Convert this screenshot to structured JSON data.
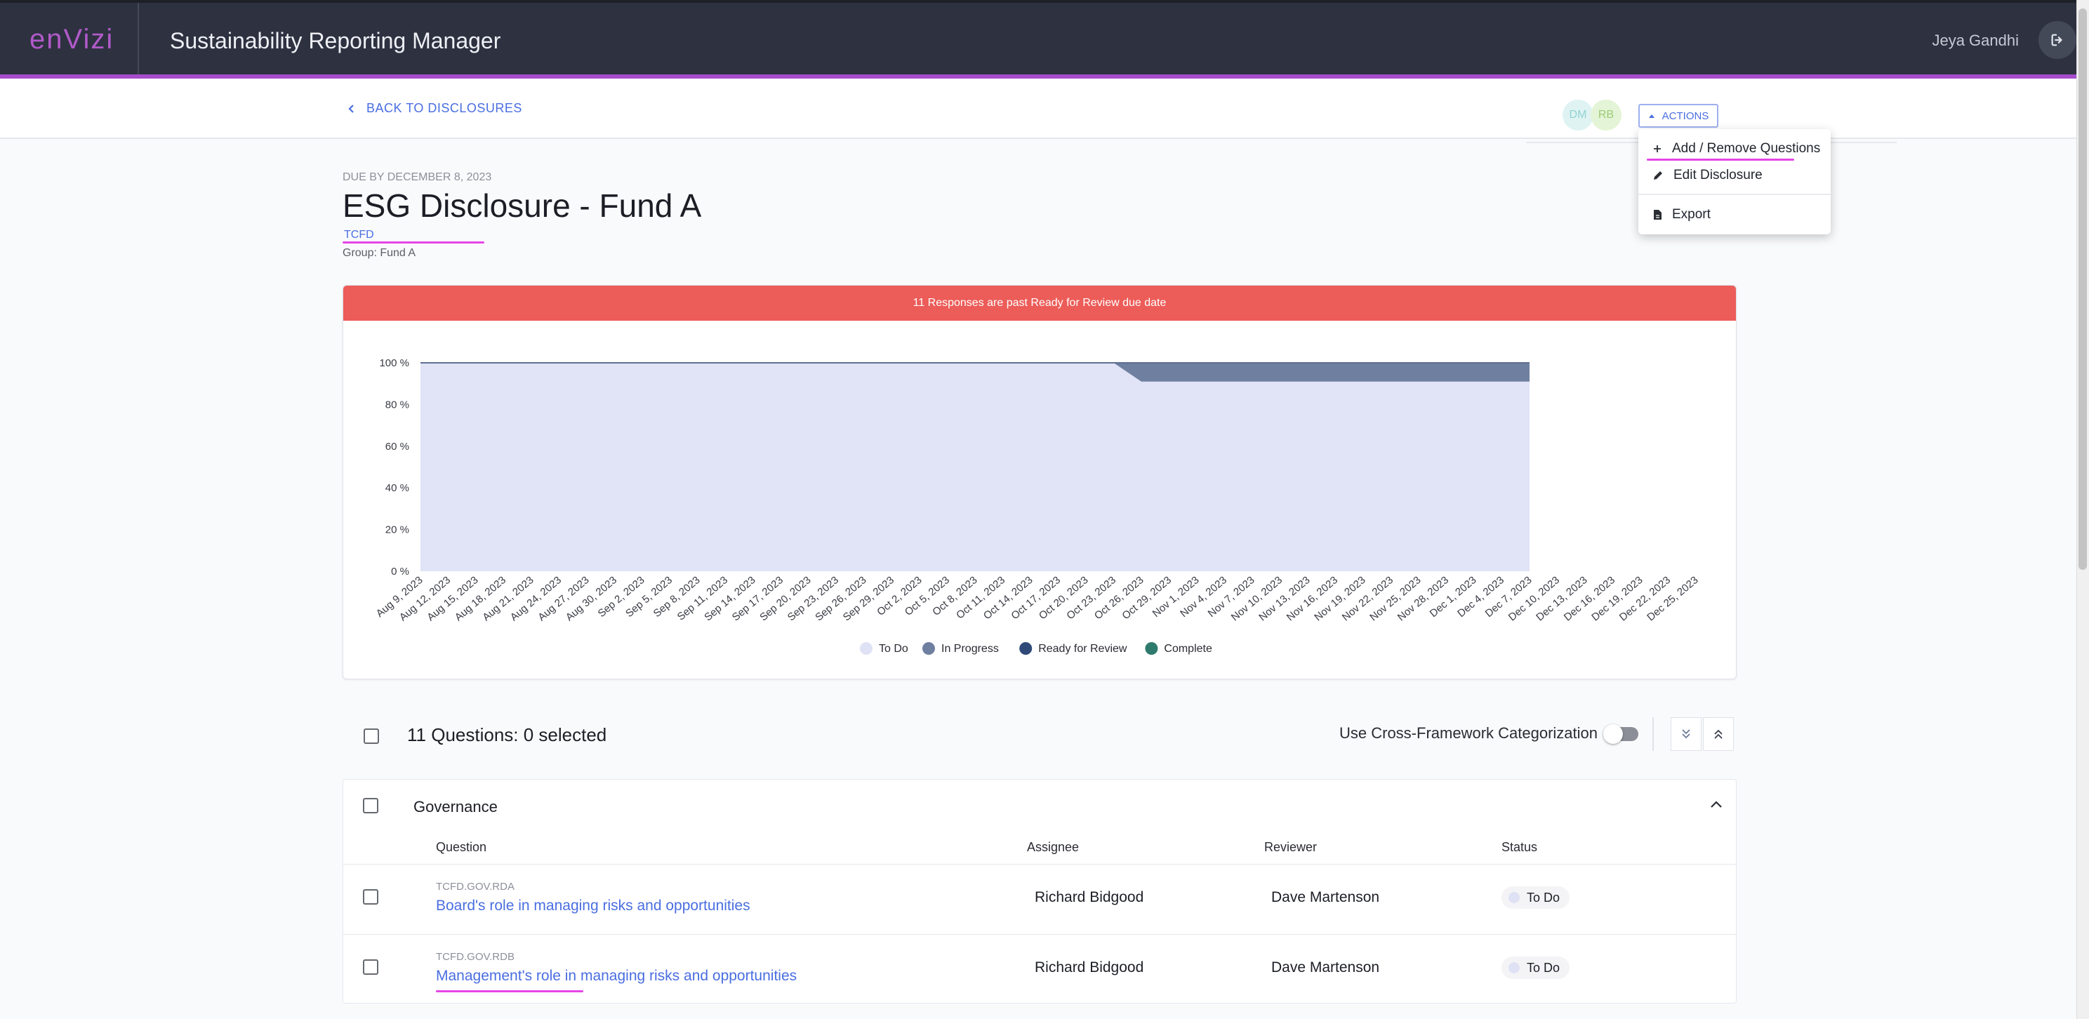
{
  "header": {
    "logo": "enVizi",
    "app_title": "Sustainability Reporting Manager",
    "user_name": "Jeya Gandhi"
  },
  "subheader": {
    "back_label": "BACK TO DISCLOSURES",
    "avatars": [
      "DM",
      "RB"
    ],
    "actions_label": "ACTIONS"
  },
  "actions_menu": {
    "items": [
      "Add / Remove Questions",
      "Edit Disclosure",
      "Export"
    ]
  },
  "disclosure": {
    "due": "DUE BY DECEMBER 8, 2023",
    "title": "ESG Disclosure - Fund A",
    "framework": "TCFD",
    "group": "Group: Fund A",
    "banner": "11 Responses are past Ready for Review due date"
  },
  "chart_data": {
    "type": "area",
    "x": [
      "Aug 9, 2023",
      "Aug 12, 2023",
      "Aug 15, 2023",
      "Aug 18, 2023",
      "Aug 21, 2023",
      "Aug 24, 2023",
      "Aug 27, 2023",
      "Aug 30, 2023",
      "Sep 2, 2023",
      "Sep 5, 2023",
      "Sep 8, 2023",
      "Sep 11, 2023",
      "Sep 14, 2023",
      "Sep 17, 2023",
      "Sep 20, 2023",
      "Sep 23, 2023",
      "Sep 26, 2023",
      "Sep 29, 2023",
      "Oct 2, 2023",
      "Oct 5, 2023",
      "Oct 8, 2023",
      "Oct 11, 2023",
      "Oct 14, 2023",
      "Oct 17, 2023",
      "Oct 20, 2023",
      "Oct 23, 2023",
      "Oct 26, 2023",
      "Oct 29, 2023",
      "Nov 1, 2023",
      "Nov 4, 2023",
      "Nov 7, 2023",
      "Nov 10, 2023",
      "Nov 13, 2023",
      "Nov 16, 2023",
      "Nov 19, 2023",
      "Nov 22, 2023",
      "Nov 25, 2023",
      "Nov 28, 2023",
      "Dec 1, 2023",
      "Dec 4, 2023",
      "Dec 7, 2023",
      "Dec 10, 2023",
      "Dec 13, 2023",
      "Dec 16, 2023",
      "Dec 19, 2023",
      "Dec 22, 2023",
      "Dec 25, 2023"
    ],
    "yticks": [
      "0 %",
      "20 %",
      "40 %",
      "60 %",
      "80 %",
      "100 %"
    ],
    "ylim": [
      0,
      100
    ],
    "stacked": true,
    "series": [
      {
        "name": "To Do",
        "color": "#dfe2f5",
        "values": [
          100,
          100,
          100,
          100,
          100,
          100,
          100,
          100,
          100,
          100,
          100,
          100,
          100,
          100,
          100,
          100,
          100,
          100,
          100,
          100,
          100,
          100,
          100,
          100,
          100,
          100,
          91,
          91,
          91,
          91,
          91,
          91,
          91,
          91,
          91,
          91,
          91,
          91,
          91,
          91,
          91,
          null,
          null,
          null,
          null,
          null,
          null
        ]
      },
      {
        "name": "In Progress",
        "color": "#6f7f9f",
        "values": [
          0,
          0,
          0,
          0,
          0,
          0,
          0,
          0,
          0,
          0,
          0,
          0,
          0,
          0,
          0,
          0,
          0,
          0,
          0,
          0,
          0,
          0,
          0,
          0,
          0,
          0,
          9,
          9,
          9,
          9,
          9,
          9,
          9,
          9,
          9,
          9,
          9,
          9,
          9,
          9,
          9,
          null,
          null,
          null,
          null,
          null,
          null
        ]
      },
      {
        "name": "Ready for Review",
        "color": "#2f4a78",
        "values": [
          0,
          0,
          0,
          0,
          0,
          0,
          0,
          0,
          0,
          0,
          0,
          0,
          0,
          0,
          0,
          0,
          0,
          0,
          0,
          0,
          0,
          0,
          0,
          0,
          0,
          0,
          0,
          0,
          0,
          0,
          0,
          0,
          0,
          0,
          0,
          0,
          0,
          0,
          0,
          0,
          0,
          null,
          null,
          null,
          null,
          null,
          null
        ]
      },
      {
        "name": "Complete",
        "color": "#2e7a6c",
        "values": [
          0,
          0,
          0,
          0,
          0,
          0,
          0,
          0,
          0,
          0,
          0,
          0,
          0,
          0,
          0,
          0,
          0,
          0,
          0,
          0,
          0,
          0,
          0,
          0,
          0,
          0,
          0,
          0,
          0,
          0,
          0,
          0,
          0,
          0,
          0,
          0,
          0,
          0,
          0,
          0,
          0,
          null,
          null,
          null,
          null,
          null,
          null
        ]
      }
    ],
    "legend_position": "bottom"
  },
  "questions": {
    "count_label": "11 Questions: 0 selected",
    "cross_label": "Use Cross-Framework Categorization",
    "section": "Governance",
    "columns": [
      "Question",
      "Assignee",
      "Reviewer",
      "Status"
    ],
    "rows": [
      {
        "code": "TCFD.GOV.RDA",
        "title": "Board's role in managing risks and opportunities",
        "assignee": "Richard Bidgood",
        "reviewer": "Dave Martenson",
        "status": "To Do"
      },
      {
        "code": "TCFD.GOV.RDB",
        "title": "Management's role in managing risks and opportunities",
        "assignee": "Richard Bidgood",
        "reviewer": "Dave Martenson",
        "status": "To Do"
      }
    ]
  }
}
